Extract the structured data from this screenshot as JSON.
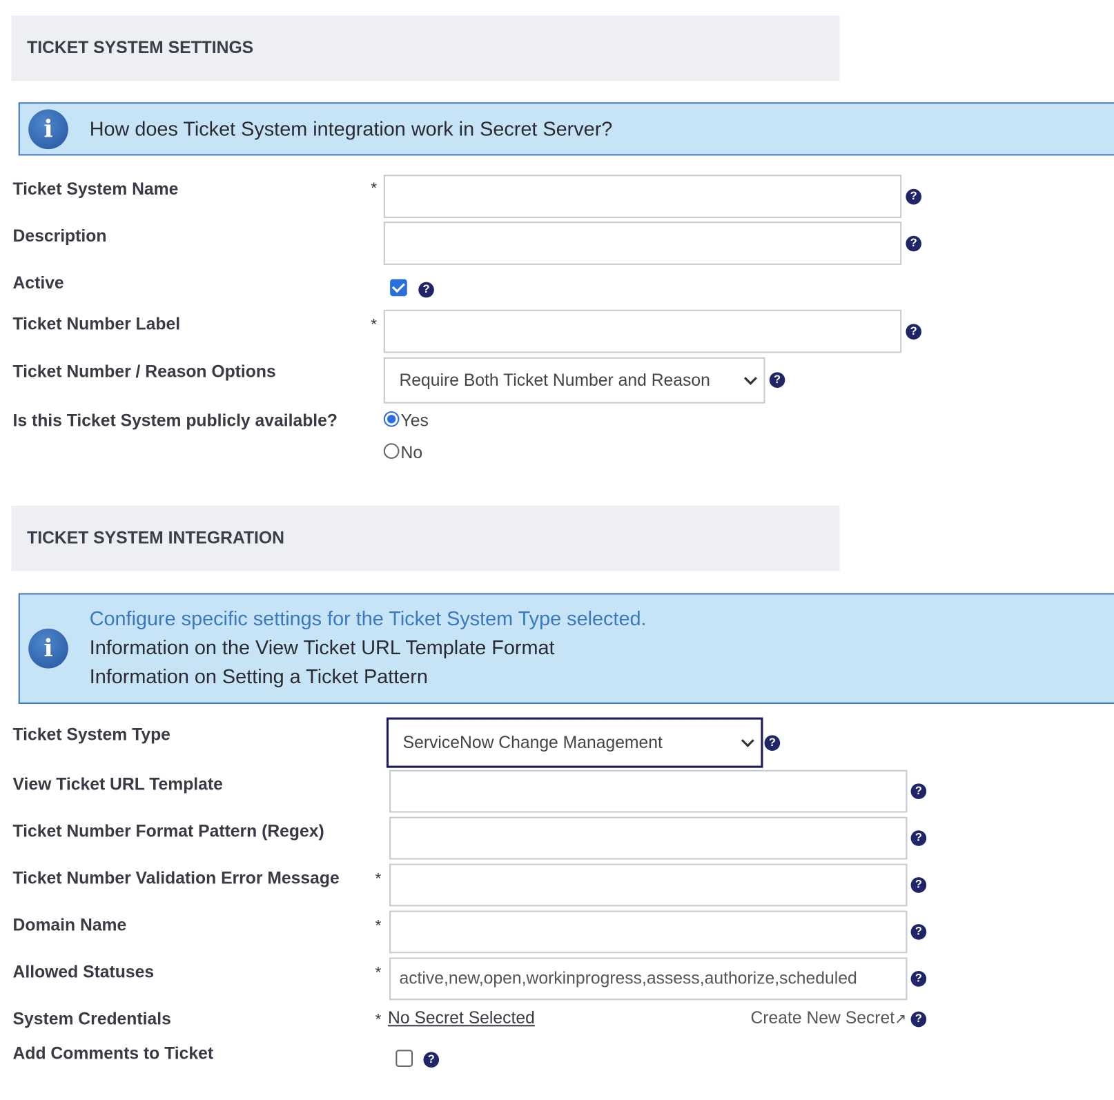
{
  "settings_section": {
    "title": "TICKET SYSTEM SETTINGS",
    "info_text": "How does Ticket System integration work in Secret Server?",
    "fields": {
      "name": {
        "label": "Ticket System Name",
        "required": "*",
        "value": ""
      },
      "description": {
        "label": "Description",
        "value": ""
      },
      "active": {
        "label": "Active",
        "checked": true
      },
      "ticket_number_label": {
        "label": "Ticket Number Label",
        "required": "*",
        "value": ""
      },
      "reason_options": {
        "label": "Ticket Number / Reason Options",
        "selected": "Require Both Ticket Number and Reason"
      },
      "public": {
        "label": "Is this Ticket System publicly available?",
        "options": [
          "Yes",
          "No"
        ],
        "selected": "Yes"
      }
    }
  },
  "integration_section": {
    "title": "TICKET SYSTEM INTEGRATION",
    "info_lines": [
      "Configure specific settings for the Ticket System Type selected.",
      "Information on the View Ticket URL Template Format",
      "Information on Setting a Ticket Pattern"
    ],
    "fields": {
      "type": {
        "label": "Ticket System Type",
        "selected": "ServiceNow Change Management"
      },
      "url_template": {
        "label": "View Ticket URL Template",
        "value": ""
      },
      "regex": {
        "label": "Ticket Number Format Pattern (Regex)",
        "value": ""
      },
      "validation_error": {
        "label": "Ticket Number Validation Error Message",
        "required": "*",
        "value": ""
      },
      "domain": {
        "label": "Domain Name",
        "required": "*",
        "value": ""
      },
      "allowed_statuses": {
        "label": "Allowed Statuses",
        "required": "*",
        "value": "active,new,open,workinprogress,assess,authorize,scheduled"
      },
      "credentials": {
        "label": "System Credentials",
        "required": "*",
        "link": "No Secret Selected",
        "create_link": "Create New Secret"
      },
      "add_comments": {
        "label": "Add Comments to Ticket",
        "checked": false
      }
    }
  },
  "help_glyph": "?",
  "info_glyph": "i",
  "colors": {
    "info_bg": "#c6e4f6",
    "info_link": "#3a78c0",
    "help": "#1f2566",
    "checkbox": "#2a6fdb"
  }
}
